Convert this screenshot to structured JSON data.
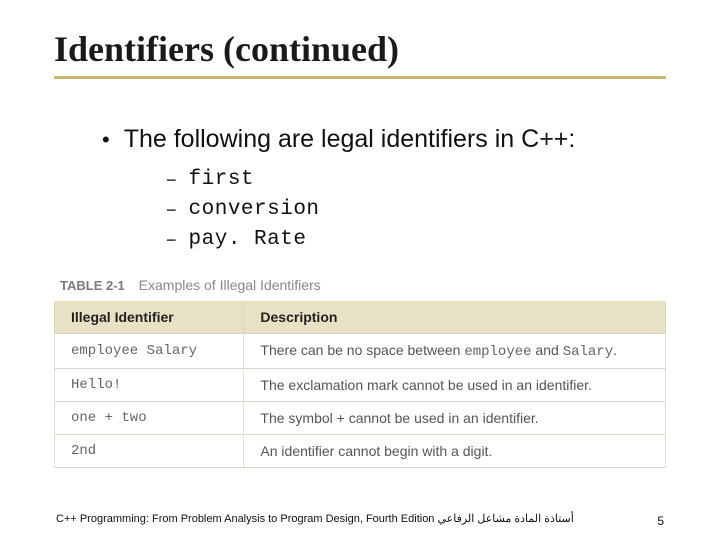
{
  "title": "Identifiers (continued)",
  "bullet1": "The following are legal identifiers in C++:",
  "legal": {
    "a": "first",
    "b": "conversion",
    "c": "pay. Rate"
  },
  "tablecap": {
    "label": "TABLE 2-1",
    "text": "Examples of Illegal Identifiers"
  },
  "headers": {
    "id": "Illegal Identifier",
    "desc": "Description"
  },
  "rows": {
    "r0": {
      "id": "employee Salary",
      "d0": "There can be no space between ",
      "m0": "employee",
      "d1": " and ",
      "m1": "Salary",
      "d2": "."
    },
    "r1": {
      "id": "Hello!",
      "d": "The exclamation mark cannot be used in an identifier."
    },
    "r2": {
      "id": "one + two",
      "d": "The symbol + cannot be used in an identifier."
    },
    "r3": {
      "id": "2nd",
      "d": "An identifier cannot begin with a digit."
    }
  },
  "footer": {
    "text": "C++ Programming: From Problem Analysis to Program Design, Fourth Edition أستاذة المادة مشاعل الرفاعي",
    "page": "5"
  }
}
